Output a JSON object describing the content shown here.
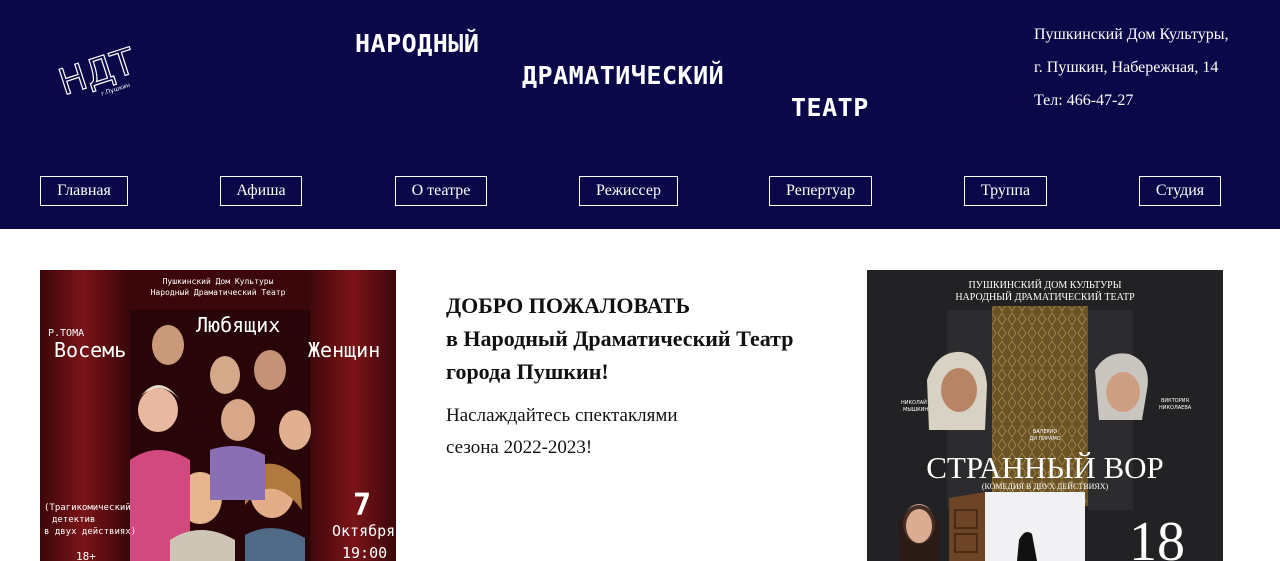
{
  "header": {
    "logo_text": "НДТ",
    "logo_subtext": "г.Пушкин",
    "title_words": [
      "НАРОДНЫЙ",
      "ДРАМАТИЧЕСКИЙ",
      "ТЕАТР"
    ],
    "contacts": [
      "Пушкинский Дом Культуры,",
      "г. Пушкин, Набережная, 14",
      "Тел: 466-47-27"
    ]
  },
  "nav": [
    "Главная",
    "Афиша",
    "О театре",
    "Режиссер",
    "Репертуар",
    "Труппа",
    "Студия"
  ],
  "welcome": {
    "heading": [
      "ДОБРО ПОЖАЛОВАТЬ",
      "в Народный Драматический Театр",
      "города Пушкин!"
    ],
    "text": [
      "Наслаждайтесь спектаклями",
      "сезона 2022-2023!"
    ]
  },
  "poster_left": {
    "top_lines": [
      "Пушкинский Дом Культуры",
      "Народный Драматический Театр"
    ],
    "author": "Р.ТОМА",
    "title_words": [
      "Восемь",
      "Любящих",
      "Женщин"
    ],
    "genre": [
      "(Трагикомический",
      "детектив",
      "в двух действиях)"
    ],
    "age": "18+",
    "day": "7",
    "month": "Октября",
    "time": "19:00",
    "colors": {
      "curtain": "#5a0f12",
      "curtain_dark": "#3b070a"
    }
  },
  "poster_right": {
    "top_lines": [
      "ПУШКИНСКИЙ ДОМ КУЛЬТУРЫ",
      "НАРОДНЫЙ ДРАМАТИЧЕСКИЙ ТЕАТР"
    ],
    "actor_left": [
      "НИКОЛАЙ",
      "МЫШКИН"
    ],
    "actor_right": [
      "ВИКТОРИЯ",
      "НИКОЛАЕВА"
    ],
    "actor_center": [
      "ВАЛЕРИО",
      "ДИ ПИРАМО"
    ],
    "title": "СТРАННЫЙ ВОР",
    "subtitle": "(КОМЕДИЯ В ДВУХ ДЕЙСТВИЯХ)",
    "day": "18"
  }
}
